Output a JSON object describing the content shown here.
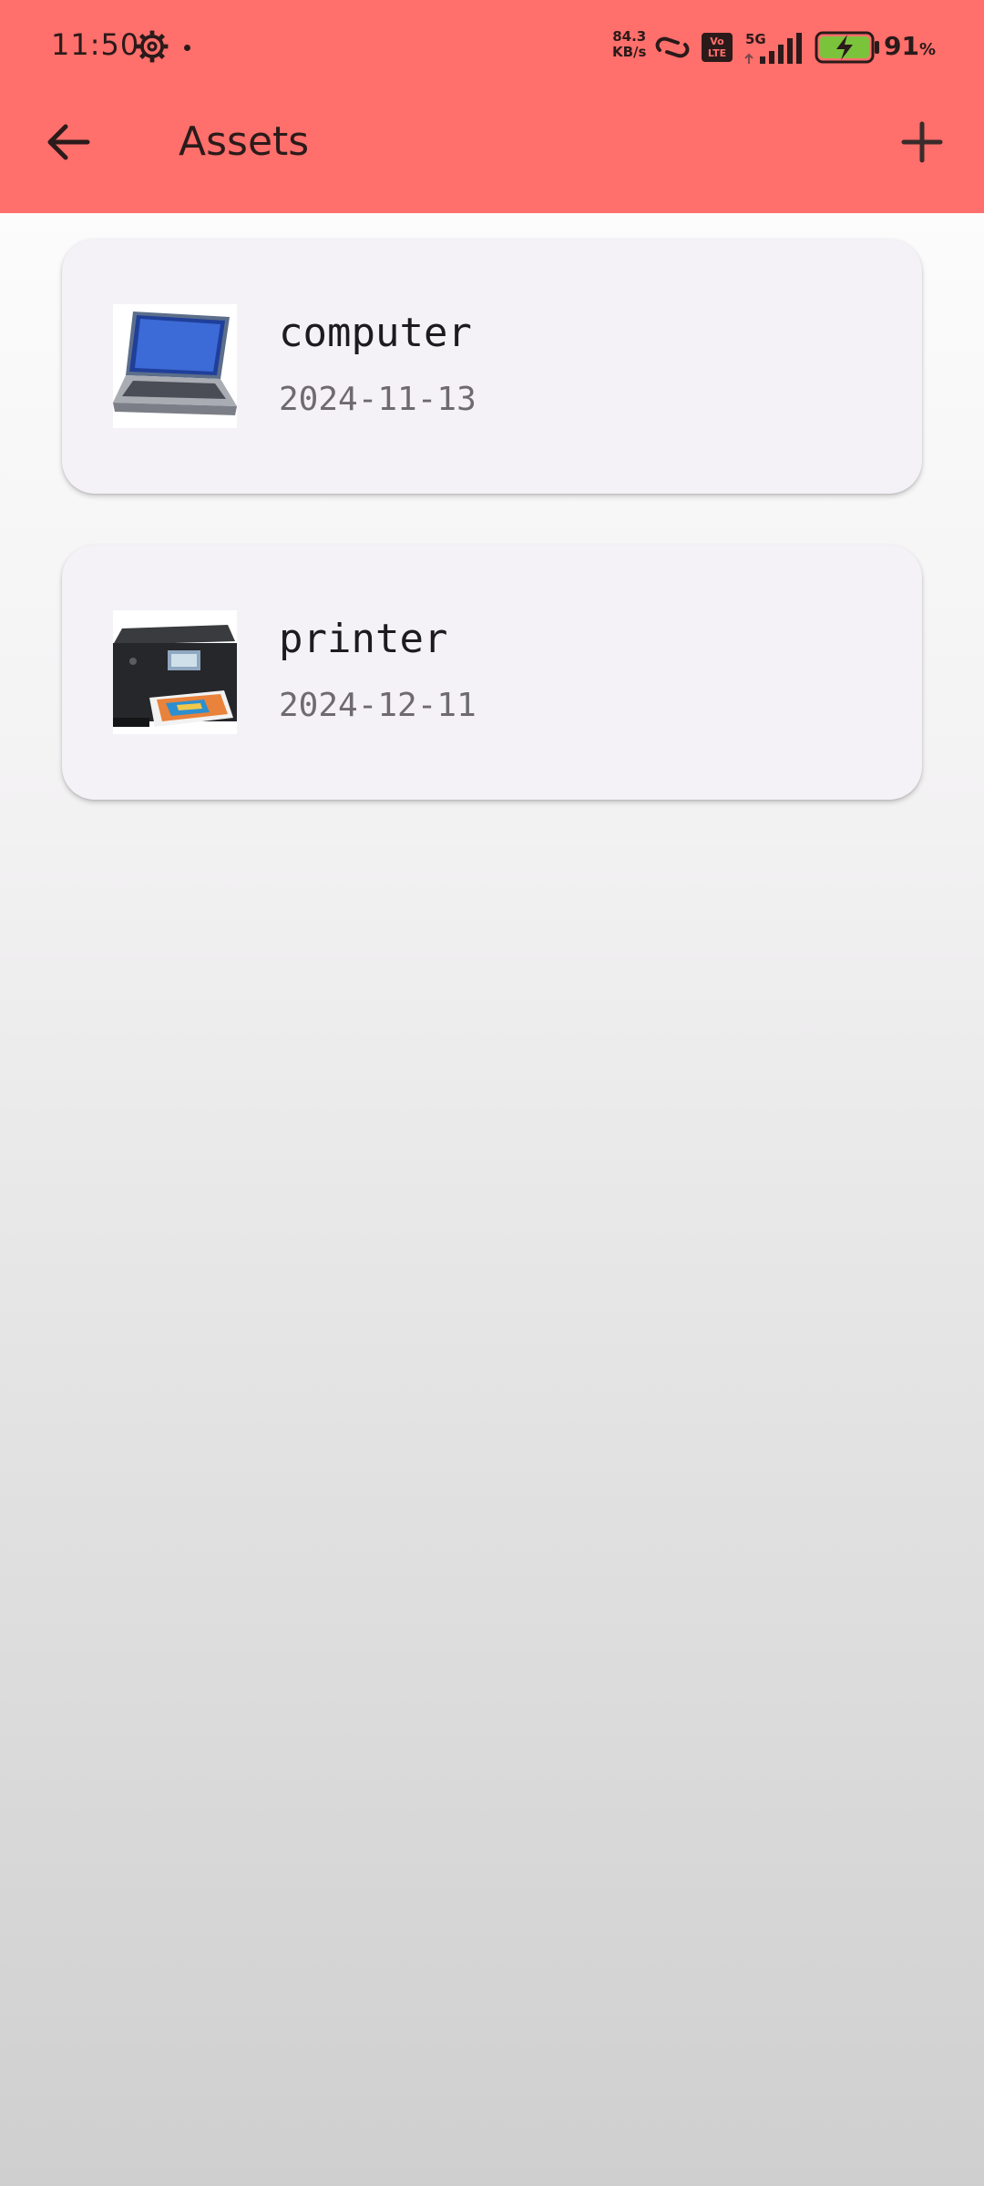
{
  "status_bar": {
    "time": "11:50",
    "net_speed_value": "84.3",
    "net_speed_unit": "KB/s",
    "volte_line1": "Vo",
    "volte_line2": "LTE",
    "network": "5G",
    "battery_percent": "91",
    "battery_unit": "%"
  },
  "app_bar": {
    "title": "Assets",
    "back_icon": "arrow-left-icon",
    "add_icon": "plus-icon"
  },
  "assets": [
    {
      "name": "computer",
      "date": "2024-11-13",
      "image": "laptop-image"
    },
    {
      "name": "printer",
      "date": "2024-12-11",
      "image": "printer-image"
    }
  ],
  "colors": {
    "app_bar": "#ff6f6b",
    "card": "#f4f1f7",
    "text_primary": "#1c1b1f",
    "text_secondary": "#6f6a72"
  }
}
